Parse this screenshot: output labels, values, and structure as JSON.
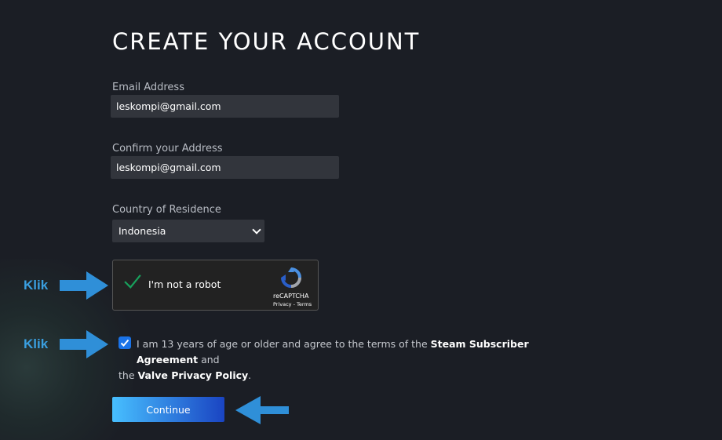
{
  "form": {
    "title": "CREATE YOUR ACCOUNT",
    "email_label": "Email Address",
    "email_value": "leskompi@gmail.com",
    "confirm_label": "Confirm your Address",
    "confirm_value": "leskompi@gmail.com",
    "country_label": "Country of Residence",
    "country_value": "Indonesia"
  },
  "captcha": {
    "label": "I'm not a robot",
    "brand": "reCAPTCHA",
    "privacy": "Privacy",
    "sep": " - ",
    "terms": "Terms",
    "checked": true
  },
  "agreement": {
    "text_1": "I am 13 years of age or older and agree to the terms of the ",
    "link_1": "Steam Subscriber Agreement",
    "text_2": " and",
    "text_3": "the ",
    "link_2": "Valve Privacy Policy",
    "text_4": ".",
    "checked": true
  },
  "continue_label": "Continue",
  "annotations": {
    "klik_1": "Klik",
    "klik_2": "Klik",
    "arrow_color": "#2f8fd8"
  },
  "colors": {
    "background": "#1b1e25",
    "input_bg": "#32353c",
    "accent": "#1a73e8",
    "check_green": "#18a05c"
  },
  "icons": {
    "captcha_check": "green-checkmark-icon",
    "captcha_logo": "recaptcha-logo-icon",
    "select_arrow": "chevron-down-icon",
    "agree_check": "checkbox-checked-icon"
  }
}
